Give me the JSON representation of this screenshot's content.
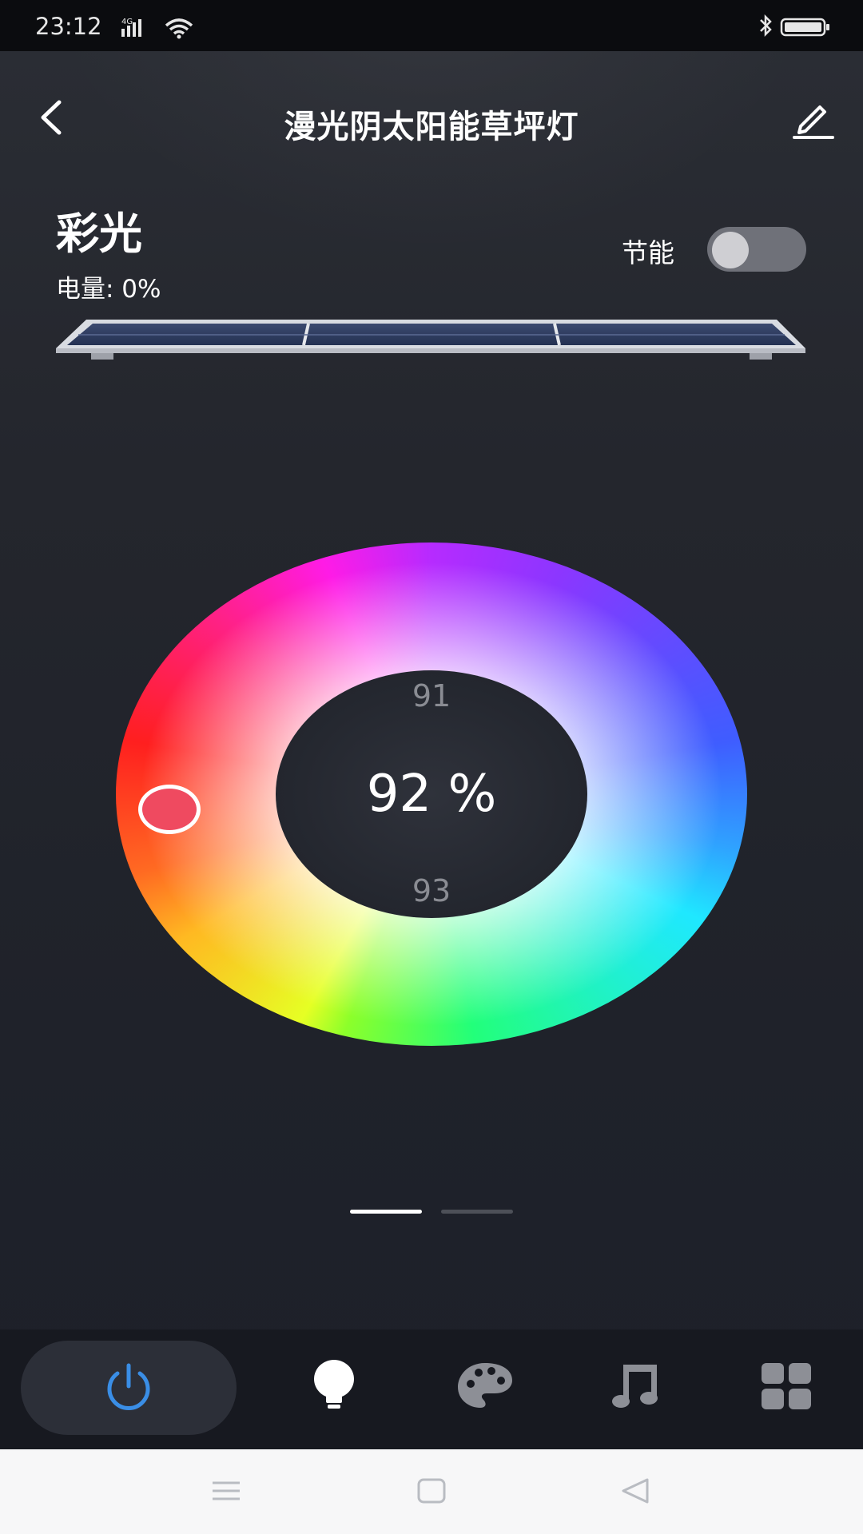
{
  "status_bar": {
    "time": "23:12",
    "network_label": "4G",
    "icons": [
      "signal-icon",
      "wifi-icon",
      "bluetooth-icon",
      "battery-icon"
    ]
  },
  "header": {
    "title": "漫光阴太阳能草坪灯",
    "back_icon": "chevron-left-icon",
    "edit_icon": "pencil-icon"
  },
  "device": {
    "mode_title": "彩光",
    "battery_text": "电量: 0%",
    "eco_label": "节能",
    "eco_enabled": false
  },
  "color_picker": {
    "prev_value": "91",
    "current_value": "92 %",
    "next_value": "93",
    "selected_color": "#ef4a60"
  },
  "page_indicator": {
    "pages": 2,
    "active": 1
  },
  "bottom_nav": {
    "items": [
      "power-icon",
      "bulb-icon",
      "palette-icon",
      "music-icon",
      "grid-icon"
    ],
    "active_color": "#3a8ee6"
  },
  "android_nav": [
    "menu-icon",
    "home-icon",
    "back-icon"
  ],
  "colors": {
    "background": "#1c1f27",
    "toggle_off": "#6f7179",
    "accent": "#3a8ee6"
  }
}
